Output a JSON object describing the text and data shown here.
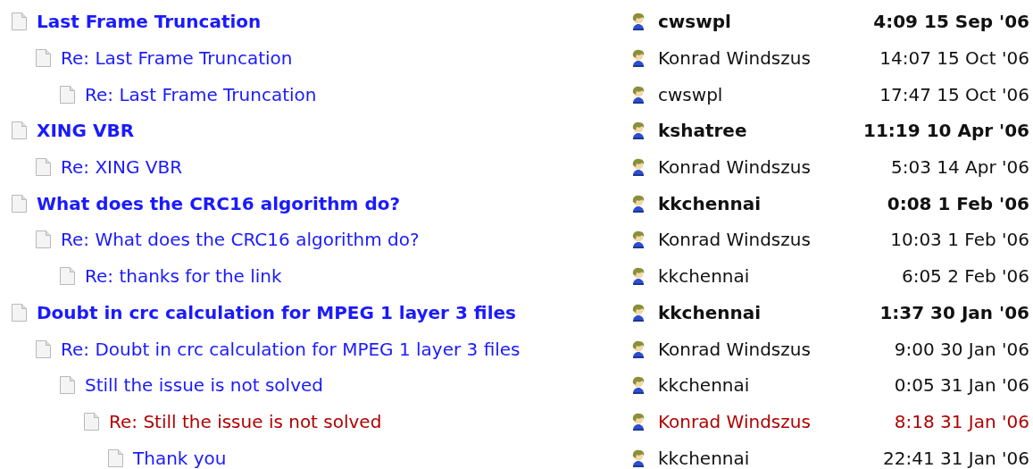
{
  "threads": [
    {
      "title": "Last Frame Truncation",
      "author": "cwswpl",
      "date": "4:09 15 Sep '06",
      "selected": false,
      "children": [
        {
          "title": "Re: Last Frame Truncation",
          "author": "Konrad Windszus",
          "date": "14:07 15 Oct '06",
          "selected": false,
          "children": [
            {
              "title": "Re: Last Frame Truncation",
              "author": "cwswpl",
              "date": "17:47 15 Oct '06",
              "selected": false
            }
          ]
        }
      ]
    },
    {
      "title": "XING VBR",
      "author": "kshatree",
      "date": "11:19 10 Apr '06",
      "selected": false,
      "children": [
        {
          "title": "Re: XING VBR",
          "author": "Konrad Windszus",
          "date": "5:03 14 Apr '06",
          "selected": false
        }
      ]
    },
    {
      "title": "What does the CRC16 algorithm do?",
      "author": "kkchennai",
      "date": "0:08 1 Feb '06",
      "selected": false,
      "children": [
        {
          "title": "Re: What does the CRC16 algorithm do?",
          "author": "Konrad Windszus",
          "date": "10:03 1 Feb '06",
          "selected": false,
          "children": [
            {
              "title": "Re: thanks for the link",
              "author": "kkchennai",
              "date": "6:05 2 Feb '06",
              "selected": false
            }
          ]
        }
      ]
    },
    {
      "title": "Doubt in crc calculation for MPEG 1 layer 3 files",
      "author": "kkchennai",
      "date": "1:37 30 Jan '06",
      "selected": false,
      "children": [
        {
          "title": "Re: Doubt in crc calculation for MPEG 1 layer 3 files",
          "author": "Konrad Windszus",
          "date": "9:00 30 Jan '06",
          "selected": false,
          "children": [
            {
              "title": "Still the issue is not solved",
              "author": "kkchennai",
              "date": "0:05 31 Jan '06",
              "selected": false,
              "children": [
                {
                  "title": "Re: Still the issue is not solved",
                  "author": "Konrad Windszus",
                  "date": "8:18 31 Jan '06",
                  "selected": true,
                  "children": [
                    {
                      "title": "Thank you",
                      "author": "kkchennai",
                      "date": "22:41 31 Jan '06",
                      "selected": false
                    }
                  ]
                }
              ]
            }
          ]
        }
      ]
    }
  ]
}
